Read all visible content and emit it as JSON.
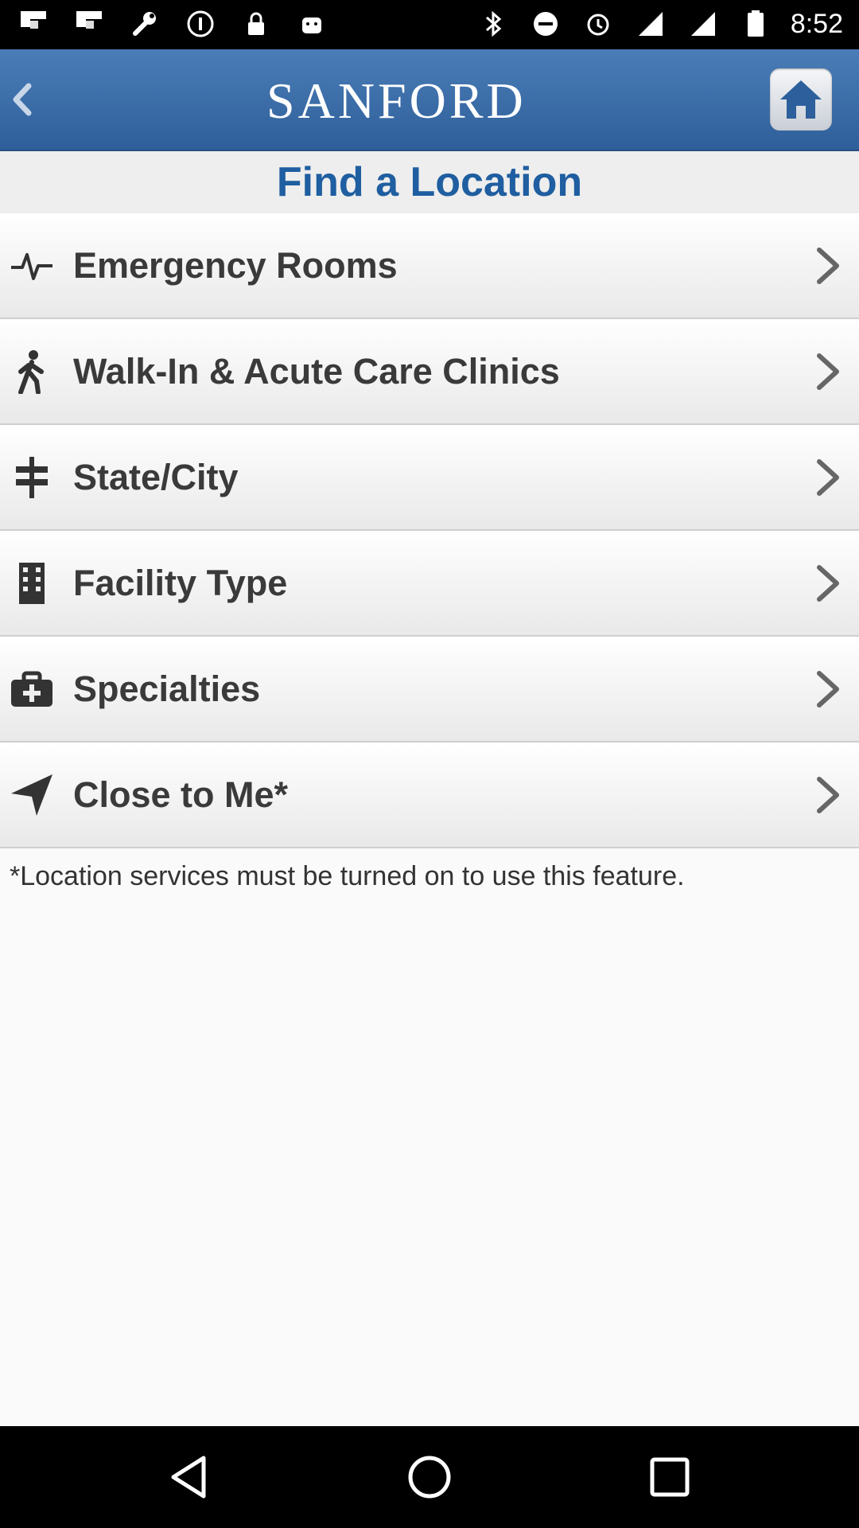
{
  "status_bar": {
    "time": "8:52"
  },
  "app_bar": {
    "logo_text": "SANFORD",
    "brand_color": "#2f5f9a"
  },
  "page": {
    "title": "Find a Location"
  },
  "menu_items": [
    {
      "label": "Emergency Rooms",
      "icon": "heartbeat-icon"
    },
    {
      "label": "Walk-In & Acute Care Clinics",
      "icon": "walking-person-icon"
    },
    {
      "label": "State/City",
      "icon": "signpost-icon"
    },
    {
      "label": "Facility Type",
      "icon": "building-icon"
    },
    {
      "label": "Specialties",
      "icon": "medical-briefcase-icon"
    },
    {
      "label": "Close to Me*",
      "icon": "location-arrow-icon"
    }
  ],
  "footnote": "*Location services must be turned on to use this feature."
}
